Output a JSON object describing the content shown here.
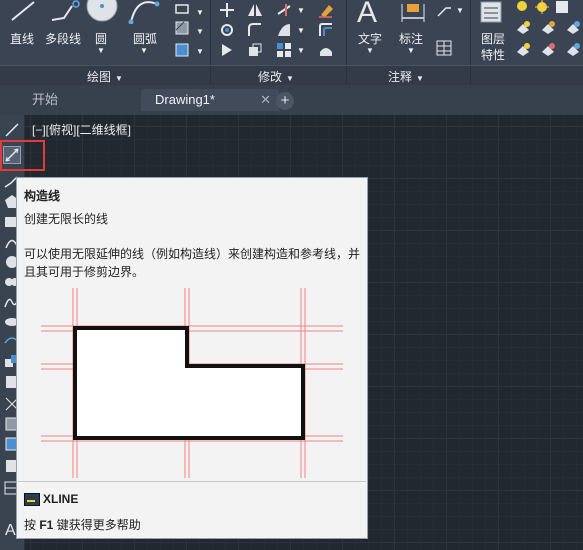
{
  "ribbon": {
    "draw": {
      "line": "直线",
      "polyline": "多段线",
      "circle": "圆",
      "arc": "圆弧",
      "panel_title": "绘图"
    },
    "modify": {
      "panel_title": "修改"
    },
    "annotation": {
      "text": "文字",
      "dimension": "标注",
      "panel_title": "注释"
    },
    "layers": {
      "properties_line1": "图层",
      "properties_line2": "特性"
    }
  },
  "tabs": [
    {
      "label": "开始"
    },
    {
      "label": "Drawing1*",
      "close": "✕"
    }
  ],
  "new_tab": "+",
  "viewport_label": "[−][俯视][二维线框]",
  "tooltip": {
    "title": "构造线",
    "subtitle": "创建无限长的线",
    "description": "可以使用无限延伸的线（例如构造线）来创建构造和参考线，并且其可用于修剪边界。",
    "command": "XLINE",
    "help_prefix": "按 ",
    "help_key": "F1",
    "help_suffix": " 键获得更多帮助"
  },
  "colors": {
    "highlight": "#e23b3b",
    "ribbon_bg": "#3b4453",
    "canvas_bg": "#212830"
  }
}
